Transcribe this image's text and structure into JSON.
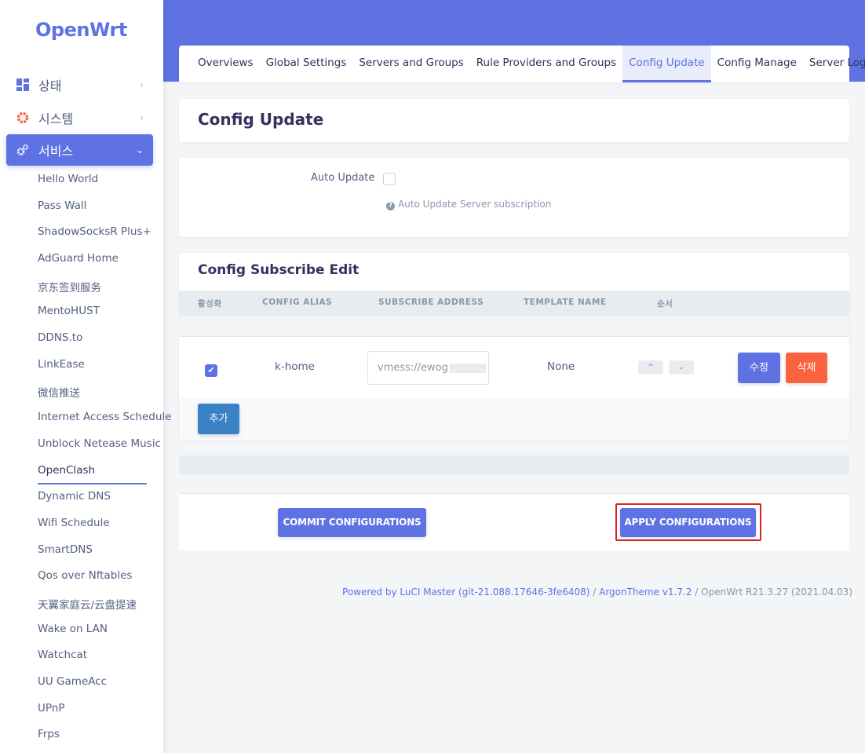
{
  "sidebar": {
    "logo": "OpenWrt",
    "menu": [
      {
        "label": "상태",
        "icon": "dashboard-icon",
        "chevron": "›"
      },
      {
        "label": "시스템",
        "icon": "gear-icon",
        "chevron": "›"
      },
      {
        "label": "서비스",
        "icon": "cogs-icon",
        "chevron": "⌄"
      }
    ],
    "services": [
      "Hello World",
      "Pass Wall",
      "ShadowSocksR Plus+",
      "AdGuard Home",
      "京东签到服务",
      "MentoHUST",
      "DDNS.to",
      "LinkEase",
      "微信推送",
      "Internet Access Schedule",
      "Unblock Netease Music",
      "OpenClash",
      "Dynamic DNS",
      "Wifi Schedule",
      "SmartDNS",
      "Qos over Nftables",
      "天翼家庭云/云盘提速",
      "Wake on LAN",
      "Watchcat",
      "UU GameAcc",
      "UPnP",
      "Frps"
    ],
    "active_service": "OpenClash"
  },
  "tabs": [
    "Overviews",
    "Global Settings",
    "Servers and Groups",
    "Rule Providers and Groups",
    "Config Update",
    "Config Manage",
    "Server Logs"
  ],
  "active_tab": "Config Update",
  "page_title": "Config Update",
  "auto_update": {
    "label": "Auto Update",
    "checked": false,
    "help": "Auto Update Server subscription"
  },
  "subscribe": {
    "title": "Config Subscribe Edit",
    "columns": [
      "활성화",
      "CONFIG ALIAS",
      "SUBSCRIBE ADDRESS",
      "TEMPLATE NAME",
      "순서"
    ],
    "row": {
      "enabled": true,
      "alias": "k-home",
      "address": "vmess://ewog",
      "template": "None",
      "up": "^",
      "down": "⌄",
      "edit_label": "수정",
      "delete_label": "삭제"
    },
    "add_label": "추가"
  },
  "actions": {
    "commit_label": "COMMIT CONFIGURATIONS",
    "apply_label": "APPLY CONFIGURATIONS"
  },
  "footer": {
    "powered_link": "Powered by LuCI Master (git-21.088.17646-3fe6408)",
    "sep": " / ",
    "theme_link": "ArgonTheme v1.7.2",
    "version": " / OpenWrt R21.3.27 (2021.04.03)"
  },
  "colors": {
    "accent": "#5e72e4",
    "danger": "#fb6340",
    "add_button": "#3b82c4",
    "highlight_border": "#e02020"
  }
}
